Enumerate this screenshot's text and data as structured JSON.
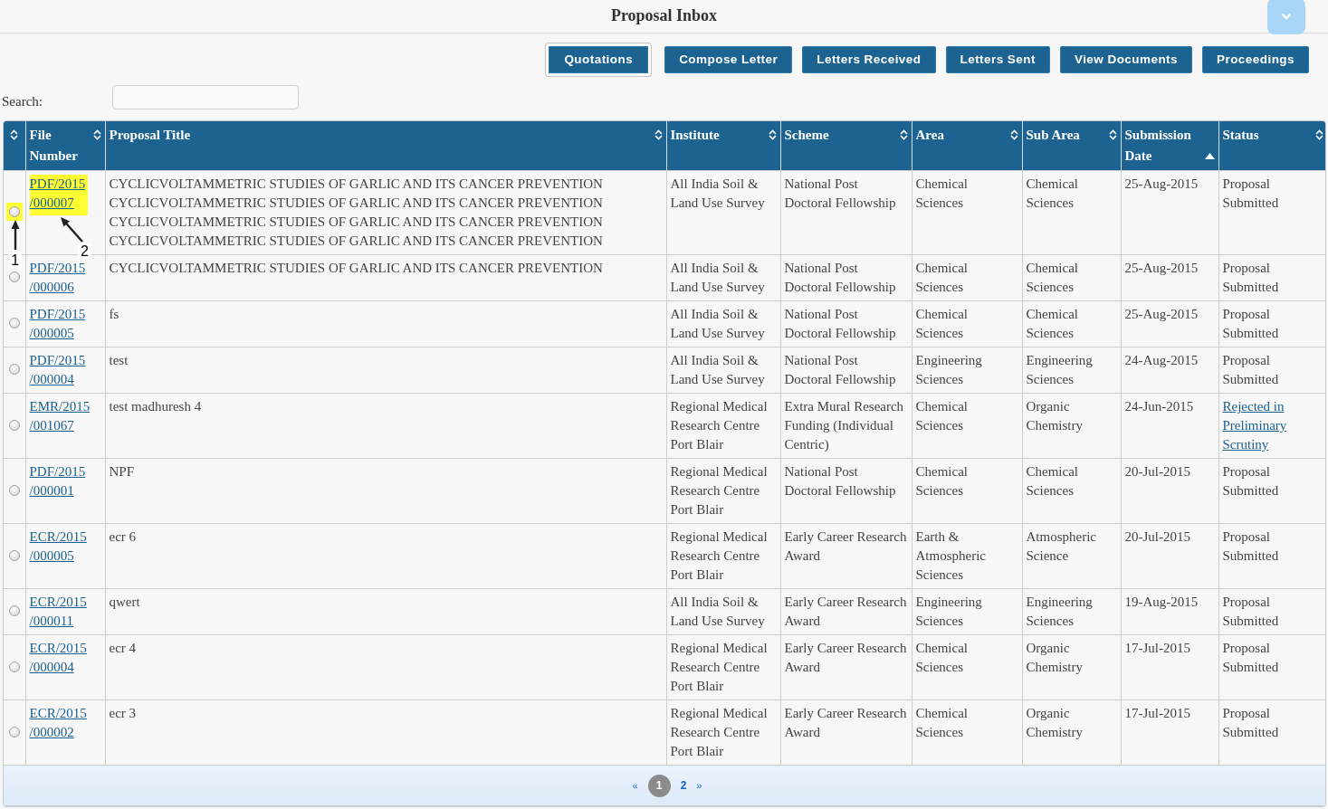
{
  "header": {
    "title": "Proposal Inbox"
  },
  "actions": [
    {
      "label": "Quotations",
      "selected": true
    },
    {
      "label": "Compose Letter",
      "selected": false
    },
    {
      "label": "Letters Received",
      "selected": false
    },
    {
      "label": "Letters Sent",
      "selected": false
    },
    {
      "label": "View Documents",
      "selected": false
    },
    {
      "label": "Proceedings",
      "selected": false
    }
  ],
  "search": {
    "label": "Search:"
  },
  "table": {
    "columns": [
      {
        "sorted_ascending": false
      },
      {
        "label": "File Number",
        "sorted_ascending": false
      },
      {
        "label": "Proposal Title",
        "sorted_ascending": false
      },
      {
        "label": "Institute",
        "sorted_ascending": false
      },
      {
        "label": "Scheme",
        "sorted_ascending": false
      },
      {
        "label": "Area",
        "sorted_ascending": false
      },
      {
        "label": "Sub Area",
        "sorted_ascending": false
      },
      {
        "label": "Submission Date",
        "sorted_ascending": true
      },
      {
        "label": "Status",
        "sorted_ascending": false
      }
    ],
    "rows": [
      {
        "selected": false,
        "highlighted": true,
        "file_number": "PDF/2015/000007",
        "title_lines": [
          "CYCLICVOLTAMMETRIC STUDIES OF GARLIC AND ITS CANCER PREVENTION",
          "CYCLICVOLTAMMETRIC STUDIES OF GARLIC AND ITS CANCER PREVENTION",
          "CYCLICVOLTAMMETRIC STUDIES OF GARLIC AND ITS CANCER PREVENTION",
          "CYCLICVOLTAMMETRIC STUDIES OF GARLIC AND ITS CANCER PREVENTION"
        ],
        "institute": "All India Soil & Land Use Survey",
        "scheme": "National Post Doctoral Fellowship",
        "area": "Chemical Sciences",
        "sub_area": "Chemical Sciences",
        "date": "25-Aug-2015",
        "status": {
          "kind": "text",
          "text": "Proposal Submitted"
        },
        "annotations": [
          {
            "kind": "radio",
            "label": "1"
          },
          {
            "kind": "file_number",
            "label": "2"
          }
        ]
      },
      {
        "selected": false,
        "highlighted": false,
        "file_number": "PDF/2015/000006",
        "title_lines": [
          "CYCLICVOLTAMMETRIC STUDIES OF GARLIC AND ITS CANCER PREVENTION"
        ],
        "institute": "All India Soil & Land Use Survey",
        "scheme": "National Post Doctoral Fellowship",
        "area": "Chemical Sciences",
        "sub_area": "Chemical Sciences",
        "date": "25-Aug-2015",
        "status": {
          "kind": "text",
          "text": "Proposal Submitted"
        }
      },
      {
        "selected": false,
        "highlighted": false,
        "file_number": "PDF/2015/000005",
        "title_lines": [
          "fs"
        ],
        "institute": "All India Soil & Land Use Survey",
        "scheme": "National Post Doctoral Fellowship",
        "area": "Chemical Sciences",
        "sub_area": "Chemical Sciences",
        "date": "25-Aug-2015",
        "status": {
          "kind": "text",
          "text": "Proposal Submitted"
        }
      },
      {
        "selected": false,
        "highlighted": false,
        "file_number": "PDF/2015/000004",
        "title_lines": [
          "test"
        ],
        "institute": "All India Soil & Land Use Survey",
        "scheme": "National Post Doctoral Fellowship",
        "area": "Engineering Sciences",
        "sub_area": "Engineering Sciences",
        "date": "24-Aug-2015",
        "status": {
          "kind": "text",
          "text": "Proposal Submitted"
        }
      },
      {
        "selected": false,
        "highlighted": false,
        "file_number": "EMR/2015/001067",
        "title_lines": [
          "test madhuresh 4"
        ],
        "institute": "Regional Medical Research Centre Port Blair",
        "scheme": "Extra Mural Research Funding (Individual Centric)",
        "area": "Chemical Sciences",
        "sub_area": "Organic Chemistry",
        "date": "24-Jun-2015",
        "status": {
          "kind": "link",
          "text": "Rejected in Preliminary Scrutiny"
        }
      },
      {
        "selected": false,
        "highlighted": false,
        "file_number": "PDF/2015/000001",
        "title_lines": [
          "NPF"
        ],
        "institute": "Regional Medical Research Centre Port Blair",
        "scheme": "National Post Doctoral Fellowship",
        "area": "Chemical Sciences",
        "sub_area": "Chemical Sciences",
        "date": "20-Jul-2015",
        "status": {
          "kind": "text",
          "text": "Proposal Submitted"
        }
      },
      {
        "selected": false,
        "highlighted": false,
        "file_number": "ECR/2015/000005",
        "title_lines": [
          "ecr 6"
        ],
        "institute": "Regional Medical Research Centre Port Blair",
        "scheme": "Early Career Research Award",
        "area": "Earth & Atmospheric Sciences",
        "sub_area": "Atmospheric Science",
        "date": "20-Jul-2015",
        "status": {
          "kind": "text",
          "text": "Proposal Submitted"
        }
      },
      {
        "selected": false,
        "highlighted": false,
        "file_number": "ECR/2015/000011",
        "title_lines": [
          "qwert"
        ],
        "institute": "All India Soil & Land Use Survey",
        "scheme": "Early Career Research Award",
        "area": "Engineering Sciences",
        "sub_area": "Engineering Sciences",
        "date": "19-Aug-2015",
        "status": {
          "kind": "text",
          "text": "Proposal Submitted"
        }
      },
      {
        "selected": false,
        "highlighted": false,
        "file_number": "ECR/2015/000004",
        "title_lines": [
          "ecr 4"
        ],
        "institute": "Regional Medical Research Centre Port Blair",
        "scheme": "Early Career Research Award",
        "area": "Chemical Sciences",
        "sub_area": "Organic Chemistry",
        "date": "17-Jul-2015",
        "status": {
          "kind": "text",
          "text": "Proposal Submitted"
        }
      },
      {
        "selected": false,
        "highlighted": false,
        "file_number": "ECR/2015/000002",
        "title_lines": [
          "ecr 3"
        ],
        "institute": "Regional Medical Research Centre Port Blair",
        "scheme": "Early Career Research Award",
        "area": "Chemical Sciences",
        "sub_area": "Organic Chemistry",
        "date": "17-Jul-2015",
        "status": {
          "kind": "text",
          "text": "Proposal Submitted"
        }
      }
    ]
  },
  "pagination": [
    {
      "kind": "prev",
      "label": "«",
      "selected": false
    },
    {
      "kind": "page",
      "label": "1",
      "selected": true
    },
    {
      "kind": "page",
      "label": "2",
      "selected": false
    },
    {
      "kind": "next",
      "label": "»",
      "selected": false
    }
  ]
}
